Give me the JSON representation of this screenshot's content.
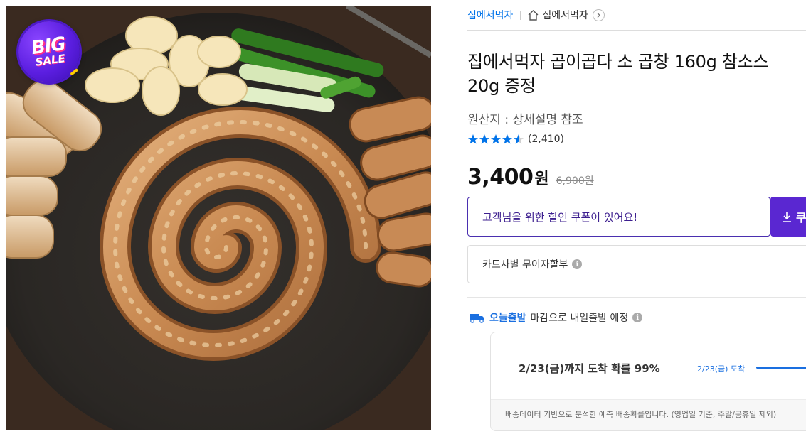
{
  "badge": {
    "line1": "BIG",
    "line2": "SALE"
  },
  "breadcrumb": {
    "seller": "집에서먹자",
    "shop": "집에서먹자"
  },
  "product": {
    "title": "집에서먹자 곱이곱다 소 곱창 160g 참소스 20g 증정",
    "origin": "원산지 : 상세설명 참조",
    "rating": 4.5,
    "review_count": "(2,410)",
    "price": "3,400",
    "price_unit": "원",
    "original_price": "6,900원"
  },
  "coupon": {
    "message": "고객님을 위한 할인 쿠폰이 있어요!",
    "button_label": "쿠"
  },
  "card": {
    "label": "카드사별 무이자할부",
    "info_glyph": "i"
  },
  "delivery": {
    "badge": "오늘출발",
    "note": "마감으로 내일출발 예정",
    "info_glyph": "i",
    "arrival_text": "2/23(금)까지 도착 확률 99%",
    "arrival_side": "2/23(금) 도착",
    "footnote": "배송데이터 기반으로 분석한 예측 배송확률입니다. (영업일 기준, 주말/공휴일 제외)"
  },
  "colors": {
    "link": "#0073e9",
    "coupon_accent": "#5a27d1",
    "delivery_blue": "#1a6fe0",
    "star": "#0073e9"
  }
}
